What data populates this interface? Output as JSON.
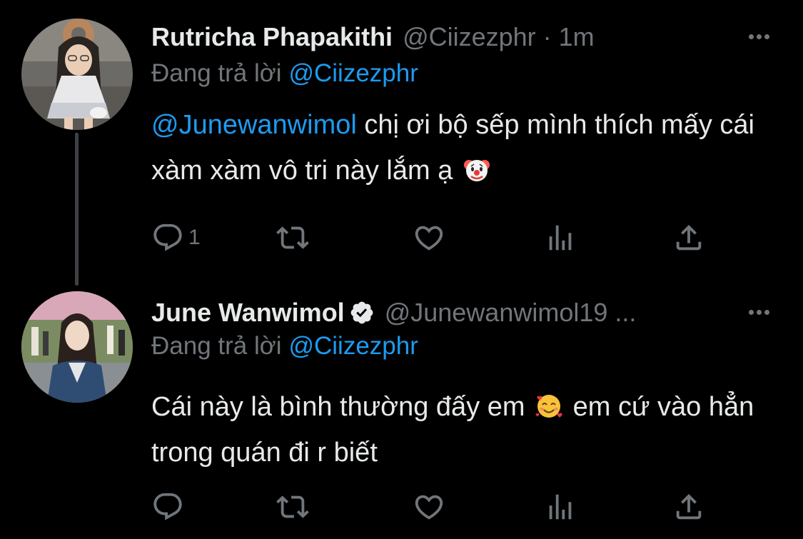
{
  "tweets": [
    {
      "display_name": "Rutricha Phapakithi",
      "handle": "@Ciizezphr",
      "separator": "·",
      "time": "1m",
      "verified": false,
      "replying_label": "Đang trả lời",
      "replying_to": "@Ciizezphr",
      "mention": "@Junewanwimol",
      "text_part1": " chị ơi bộ sếp mình thích mấy cái xàm xàm vô tri này lắm ạ ",
      "text_part2": "",
      "emoji": "clown-face-emoji",
      "reply_count": "1"
    },
    {
      "display_name": "June Wanwimol",
      "handle": "@Junewanwimol19 ...",
      "verified": true,
      "replying_label": "Đang trả lời",
      "replying_to": "@Ciizezphr",
      "text_part1": "Cái này là bình thường đấy em ",
      "text_part2": " em cứ vào hẳn trong quán đi r biết",
      "emoji": "smiling-face-with-hearts-emoji",
      "reply_count": ""
    }
  ],
  "colors": {
    "background": "#000000",
    "primary_text": "#e7e9ea",
    "secondary_text": "#71767b",
    "accent": "#1d9bf0",
    "thread_line": "#3e4144"
  },
  "icons": [
    "reply-icon",
    "retweet-icon",
    "like-icon",
    "views-icon",
    "share-icon",
    "more-icon",
    "verified-badge-icon"
  ]
}
